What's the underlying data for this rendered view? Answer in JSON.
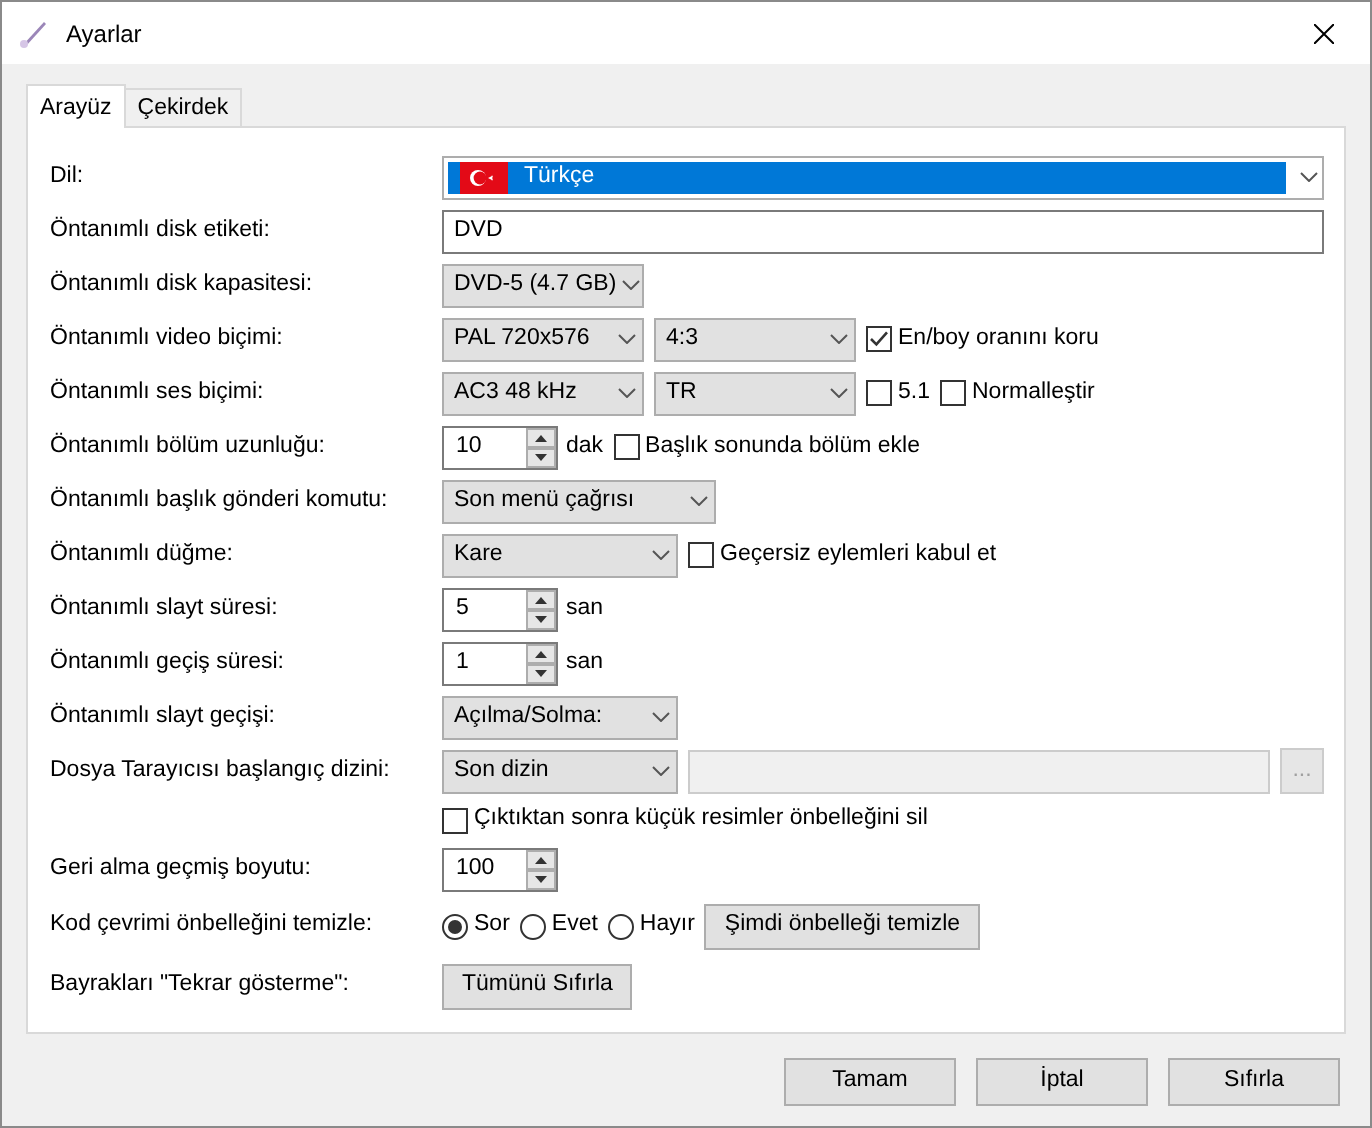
{
  "window": {
    "title": "Ayarlar"
  },
  "tabs": [
    {
      "label": "Arayüz",
      "selected": true
    },
    {
      "label": "Çekirdek",
      "selected": false
    }
  ],
  "rows": [
    {
      "label": "Dil:",
      "controls": [
        {
          "kind": "combo",
          "value": "Türkçe",
          "flag": true,
          "highlighted": true
        }
      ]
    },
    {
      "label": "Öntanımlı disk etiketi:",
      "controls": [
        {
          "kind": "text",
          "value": "DVD"
        }
      ]
    },
    {
      "label": "Öntanımlı disk kapasitesi:",
      "controls": [
        {
          "kind": "combo",
          "value": "DVD-5 (4.7 GB)"
        }
      ]
    },
    {
      "label": "Öntanımlı video biçimi:",
      "controls": [
        {
          "kind": "combo",
          "value": "PAL 720x576"
        },
        {
          "kind": "combo",
          "value": "4:3"
        },
        {
          "kind": "check",
          "label": "En/boy oranını koru",
          "checked": true
        }
      ]
    },
    {
      "label": "Öntanımlı ses biçimi:",
      "controls": [
        {
          "kind": "combo",
          "value": "AC3 48 kHz"
        },
        {
          "kind": "combo",
          "value": "TR"
        },
        {
          "kind": "check",
          "label": "5.1",
          "checked": false
        },
        {
          "kind": "check",
          "label": "Normalleştir",
          "checked": false
        }
      ]
    },
    {
      "label": "Öntanımlı bölüm uzunluğu:",
      "controls": [
        {
          "kind": "spin",
          "value": "10"
        },
        {
          "kind": "unit",
          "text": "dak"
        },
        {
          "kind": "check",
          "label": "Başlık sonunda bölüm ekle",
          "checked": false
        }
      ]
    },
    {
      "label": "Öntanımlı başlık gönderi komutu:",
      "controls": [
        {
          "kind": "combo",
          "value": "Son menü çağrısı"
        }
      ]
    },
    {
      "label": "Öntanımlı düğme:",
      "controls": [
        {
          "kind": "combo",
          "value": "Kare"
        },
        {
          "kind": "check",
          "label": "Geçersiz eylemleri kabul et",
          "checked": false
        }
      ]
    },
    {
      "label": "Öntanımlı slayt süresi:",
      "controls": [
        {
          "kind": "spin",
          "value": "5"
        },
        {
          "kind": "unit",
          "text": "san"
        }
      ]
    },
    {
      "label": "Öntanımlı geçiş süresi:",
      "controls": [
        {
          "kind": "spin",
          "value": "1"
        },
        {
          "kind": "unit",
          "text": "san"
        }
      ]
    },
    {
      "label": "Öntanımlı slayt geçişi:",
      "controls": [
        {
          "kind": "combo",
          "value": "Açılma/Solma:"
        }
      ]
    },
    {
      "label": "Dosya Tarayıcısı başlangıç dizini:",
      "controls": [
        {
          "kind": "combo",
          "value": "Son dizin"
        },
        {
          "kind": "path",
          "disabled": true
        },
        {
          "kind": "button",
          "label": "...",
          "disabled": true
        }
      ]
    },
    {
      "controls": [
        {
          "kind": "check",
          "label": "Çıktıktan sonra küçük resimler önbelleğini sil",
          "checked": false
        }
      ]
    },
    {
      "label": "Geri alma geçmiş boyutu:",
      "controls": [
        {
          "kind": "spin",
          "value": "100"
        }
      ]
    },
    {
      "label": "Kod çevrimi önbelleğini temizle:",
      "controls": [
        {
          "kind": "radio",
          "label": "Sor",
          "selected": true
        },
        {
          "kind": "radio",
          "label": "Evet",
          "selected": false
        },
        {
          "kind": "radio",
          "label": "Hayır",
          "selected": false
        },
        {
          "kind": "button",
          "label": "Şimdi önbelleği temizle"
        }
      ]
    },
    {
      "label": "Bayrakları \"Tekrar gösterme\":",
      "controls": [
        {
          "kind": "button",
          "label": "Tümünü Sıfırla"
        }
      ]
    }
  ],
  "buttons": [
    "Tamam",
    "İptal",
    "Sıfırla"
  ]
}
